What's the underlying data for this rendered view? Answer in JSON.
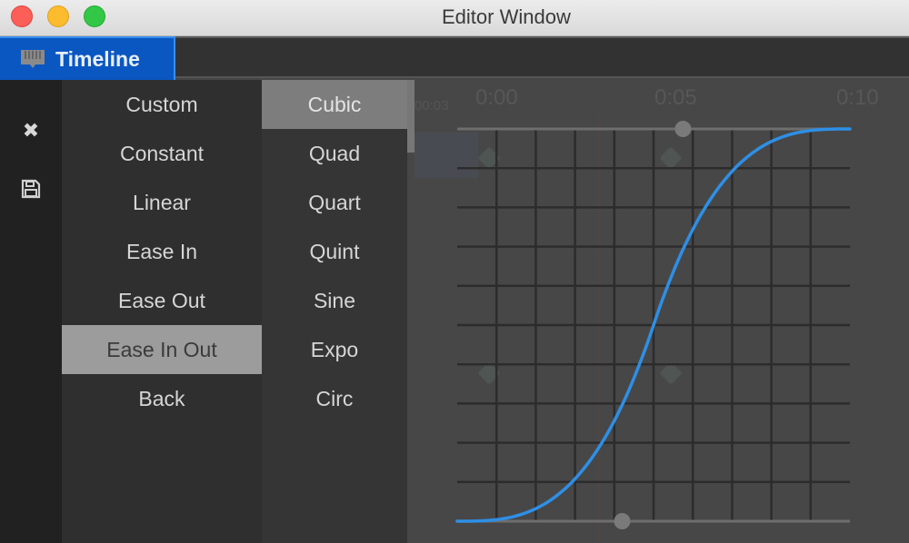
{
  "window": {
    "title": "Editor Window",
    "traffic_lights": [
      "close",
      "minimize",
      "maximize"
    ]
  },
  "tabs": [
    {
      "label": "Timeline",
      "icon": "timeline-icon",
      "active": true
    }
  ],
  "toolstrip": [
    {
      "name": "close",
      "icon": "close-icon",
      "glyph": "✖"
    },
    {
      "name": "save",
      "icon": "save-icon"
    }
  ],
  "easing_types": {
    "items": [
      "Custom",
      "Constant",
      "Linear",
      "Ease In",
      "Ease Out",
      "Ease In Out",
      "Back"
    ],
    "selected": "Ease In Out"
  },
  "easing_functions": {
    "items": [
      "Cubic",
      "Quad",
      "Quart",
      "Quint",
      "Sine",
      "Expo",
      "Circ"
    ],
    "selected": "Cubic"
  },
  "background_timeline": {
    "ruler_labels": [
      "0:00",
      "0:05",
      "0:10"
    ],
    "frame_label": "00:03"
  },
  "curve": {
    "type": "ease-in-out-cubic",
    "color": "#2e8fe6",
    "start_handle": {
      "x": 0.42,
      "y": 0.0
    },
    "end_handle": {
      "x": 0.575,
      "y": 1.0
    },
    "grid_divisions": 10
  },
  "colors": {
    "accent": "#0a57c2",
    "curve": "#2e8fe6",
    "selection": "#9c9c9c"
  }
}
